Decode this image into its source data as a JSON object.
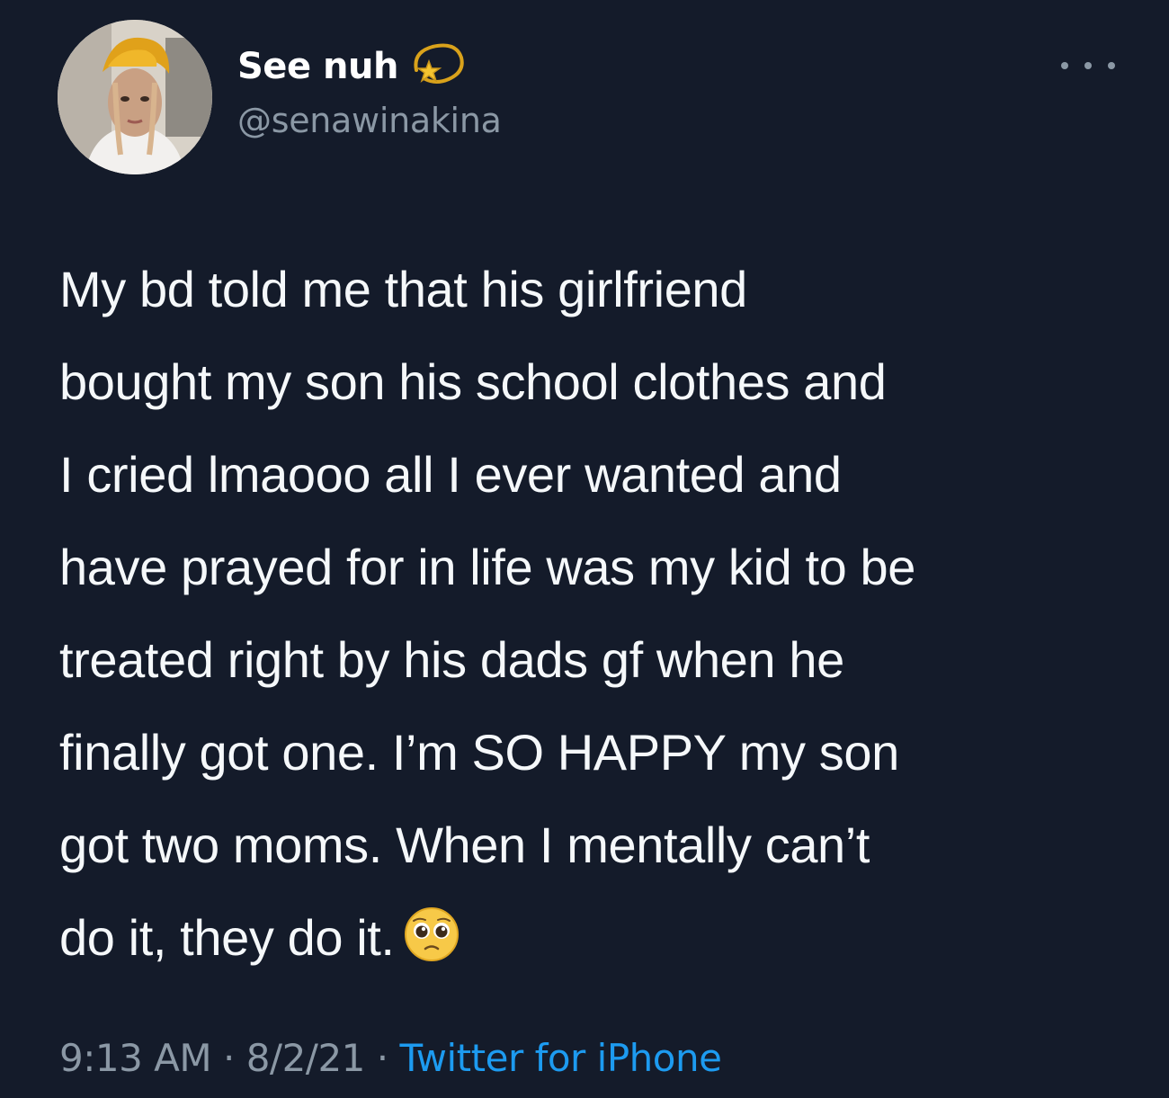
{
  "user": {
    "display_name": "See nuh",
    "name_emoji": "dizzy-star-icon",
    "handle": "@senawinakina",
    "avatar": "profile-photo"
  },
  "tweet": {
    "text": "My bd told me that his girlfriend\nbought my son his school clothes and\nI cried lmaooo all I ever wanted and\nhave prayed for in life was my kid to be\ntreated right by his dads gf when he\nfinally got one. I’m SO HAPPY my son\ngot two moms. When I mentally can’t\ndo it, they do it.",
    "emoji": "pleading-face-icon"
  },
  "meta": {
    "time": "9:13 AM",
    "separator": " · ",
    "date": "8/2/21",
    "source": "Twitter for iPhone"
  },
  "colors": {
    "background": "#141b2a",
    "text": "#f5f8fa",
    "secondary": "#8b98a5",
    "link": "#1d9bf0"
  }
}
